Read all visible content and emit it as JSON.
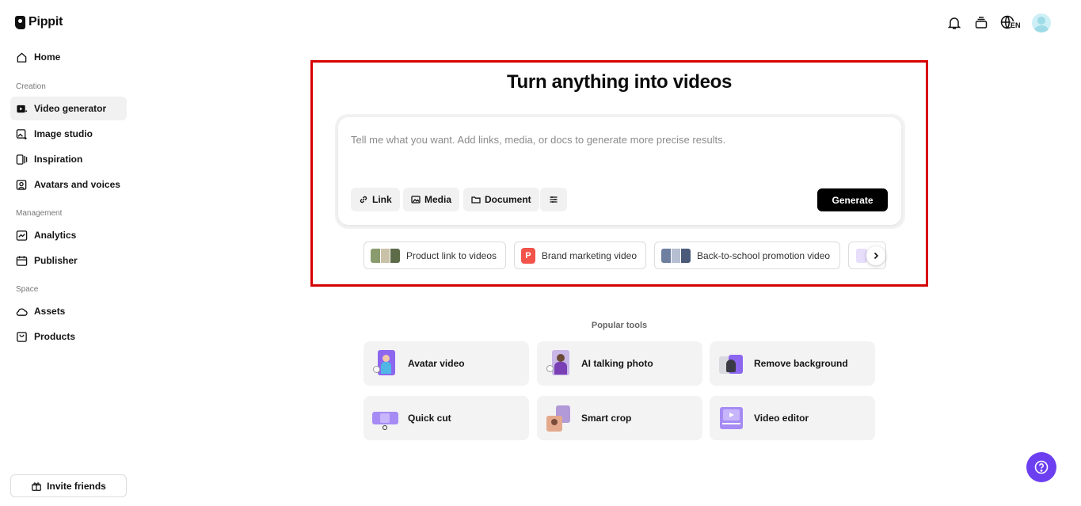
{
  "app": {
    "logo_text": "Pippit"
  },
  "sidebar": {
    "home": "Home",
    "sections": {
      "creation": "Creation",
      "management": "Management",
      "space": "Space"
    },
    "creation_items": [
      "Video generator",
      "Image studio",
      "Inspiration",
      "Avatars and voices"
    ],
    "management_items": [
      "Analytics",
      "Publisher"
    ],
    "space_items": [
      "Assets",
      "Products"
    ],
    "active_item": "Video generator",
    "invite_label": "Invite friends"
  },
  "topbar": {
    "icons": [
      "bell-icon",
      "layers-icon",
      "globe-icon",
      "avatar"
    ],
    "language": "EN"
  },
  "hero": {
    "title": "Turn anything into videos",
    "prompt_placeholder": "Tell me what you want. Add links, media, or docs to generate more precise results.",
    "buttons": {
      "link": "Link",
      "media": "Media",
      "document": "Document",
      "generate": "Generate"
    }
  },
  "suggestions": [
    {
      "label": "Product link to videos"
    },
    {
      "label": "Brand marketing video",
      "badge": "P"
    },
    {
      "label": "Back-to-school promotion video"
    }
  ],
  "popular": {
    "label": "Popular tools",
    "tools": [
      "Avatar video",
      "AI talking photo",
      "Remove background",
      "Quick cut",
      "Smart crop",
      "Video editor"
    ]
  },
  "colors": {
    "highlight": "#d50000",
    "accent": "#6c3ff0",
    "generate": "#000000",
    "badge": "#f2534a"
  }
}
